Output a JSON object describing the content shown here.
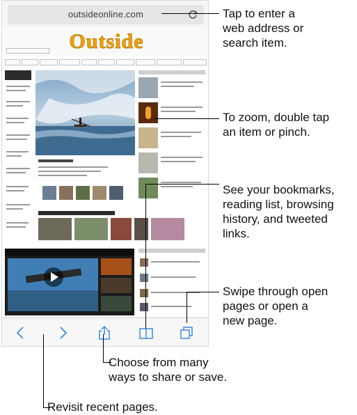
{
  "browser": {
    "url": "outsideonline.com",
    "site_logo": "Outside"
  },
  "callouts": {
    "address": "Tap to enter a\nweb address or\nsearch item.",
    "zoom": "To zoom, double tap\nan item or pinch.",
    "bookmarks": "See your bookmarks,\nreading list, browsing\nhistory, and tweeted\nlinks.",
    "tabs": "Swipe through open\npages or open a\nnew page.",
    "share": "Choose from many\nways to share or save.",
    "back": "Revisit recent pages."
  },
  "icons": {
    "reload": "reload-icon",
    "back": "chevron-left-icon",
    "forward": "chevron-right-icon",
    "share": "share-icon",
    "bookmarks": "book-icon",
    "tabs": "tabs-icon"
  },
  "colors": {
    "accent": "#3a8ee6",
    "logo": "#f2a400",
    "line": "#000000"
  }
}
